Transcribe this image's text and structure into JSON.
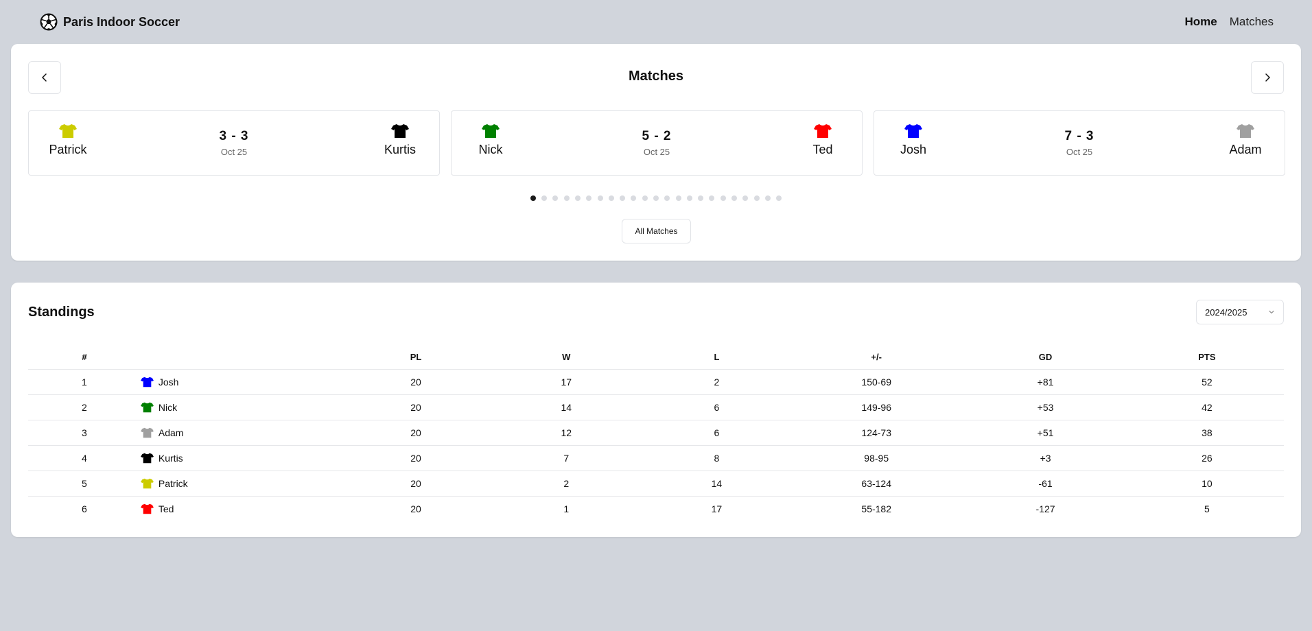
{
  "header": {
    "brand": "Paris Indoor Soccer",
    "nav": [
      {
        "label": "Home",
        "active": true
      },
      {
        "label": "Matches",
        "active": false
      }
    ]
  },
  "matches": {
    "title": "Matches",
    "cards": [
      {
        "home": "Patrick",
        "home_color": "#cccc00",
        "away": "Kurtis",
        "away_color": "#000000",
        "score": "3 - 3",
        "date": "Oct 25"
      },
      {
        "home": "Nick",
        "home_color": "#008000",
        "away": "Ted",
        "away_color": "#ff0000",
        "score": "5 - 2",
        "date": "Oct 25"
      },
      {
        "home": "Josh",
        "home_color": "#0000ff",
        "away": "Adam",
        "away_color": "#a0a0a0",
        "score": "7 - 3",
        "date": "Oct 25"
      }
    ],
    "dots_total": 23,
    "active_dot": 0,
    "all_matches_label": "All Matches"
  },
  "standings": {
    "title": "Standings",
    "season": "2024/2025",
    "columns": [
      "#",
      "",
      "PL",
      "W",
      "L",
      "+/-",
      "GD",
      "PTS"
    ],
    "rows": [
      {
        "rank": "1",
        "player": "Josh",
        "color": "#0000ff",
        "pl": "20",
        "w": "17",
        "l": "2",
        "pm": "150-69",
        "gd": "+81",
        "pts": "52"
      },
      {
        "rank": "2",
        "player": "Nick",
        "color": "#008000",
        "pl": "20",
        "w": "14",
        "l": "6",
        "pm": "149-96",
        "gd": "+53",
        "pts": "42"
      },
      {
        "rank": "3",
        "player": "Adam",
        "color": "#a0a0a0",
        "pl": "20",
        "w": "12",
        "l": "6",
        "pm": "124-73",
        "gd": "+51",
        "pts": "38"
      },
      {
        "rank": "4",
        "player": "Kurtis",
        "color": "#000000",
        "pl": "20",
        "w": "7",
        "l": "8",
        "pm": "98-95",
        "gd": "+3",
        "pts": "26"
      },
      {
        "rank": "5",
        "player": "Patrick",
        "color": "#cccc00",
        "pl": "20",
        "w": "2",
        "l": "14",
        "pm": "63-124",
        "gd": "-61",
        "pts": "10"
      },
      {
        "rank": "6",
        "player": "Ted",
        "color": "#ff0000",
        "pl": "20",
        "w": "1",
        "l": "17",
        "pm": "55-182",
        "gd": "-127",
        "pts": "5"
      }
    ]
  },
  "icons": {
    "brand": "soccer-ball-icon",
    "prev": "chevron-left-icon",
    "next": "chevron-right-icon",
    "jersey": "jersey-icon",
    "select": "chevron-down-icon"
  }
}
